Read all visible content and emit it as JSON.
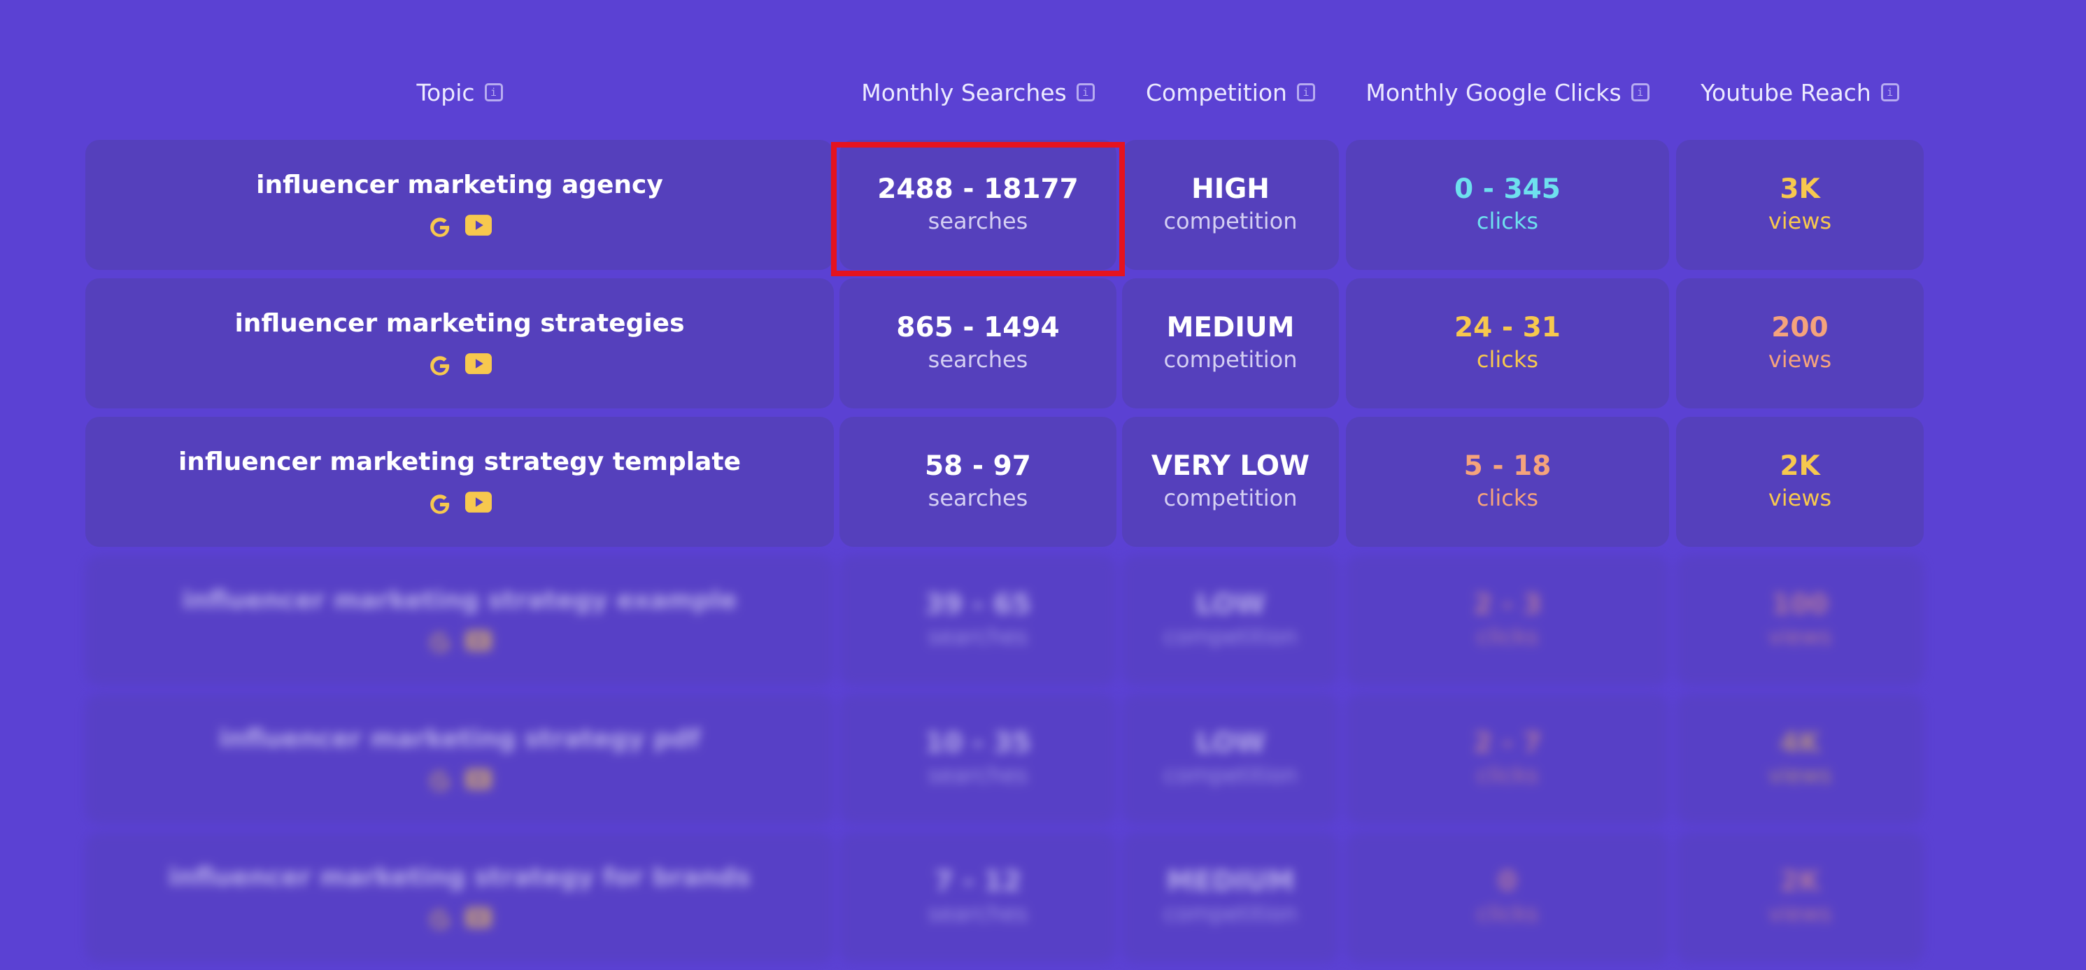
{
  "header": {
    "topic": "Topic",
    "monthly_searches": "Monthly Searches",
    "competition": "Competition",
    "monthly_google_clicks": "Monthly Google Clicks",
    "youtube_reach": "Youtube Reach"
  },
  "colors": {
    "background": "#5b41d3",
    "cell": "#5540bc",
    "cyan": "#6ee0ee",
    "yellow": "#f7c84e",
    "orange": "#f5a37c",
    "highlight": "#e5131f"
  },
  "rows": [
    {
      "topic": "influencer marketing agency",
      "searches": "2488 - 18177",
      "searches_unit": "searches",
      "competition": "HIGH",
      "competition_unit": "competition",
      "clicks": "0 - 345",
      "clicks_unit": "clicks",
      "reach": "3K",
      "reach_unit": "views"
    },
    {
      "topic": "influencer marketing strategies",
      "searches": "865 - 1494",
      "searches_unit": "searches",
      "competition": "MEDIUM",
      "competition_unit": "competition",
      "clicks": "24 - 31",
      "clicks_unit": "clicks",
      "reach": "200",
      "reach_unit": "views"
    },
    {
      "topic": "influencer marketing strategy template",
      "searches": "58 - 97",
      "searches_unit": "searches",
      "competition": "VERY LOW",
      "competition_unit": "competition",
      "clicks": "5 - 18",
      "clicks_unit": "clicks",
      "reach": "2K",
      "reach_unit": "views"
    },
    {
      "topic": "influencer marketing strategy example",
      "searches": "39 - 65",
      "searches_unit": "searches",
      "competition": "LOW",
      "competition_unit": "competition",
      "clicks": "2 - 3",
      "clicks_unit": "clicks",
      "reach": "100",
      "reach_unit": "views"
    },
    {
      "topic": "influencer marketing strategy pdf",
      "searches": "10 - 35",
      "searches_unit": "searches",
      "competition": "LOW",
      "competition_unit": "competition",
      "clicks": "2 - 7",
      "clicks_unit": "clicks",
      "reach": "4K",
      "reach_unit": "views"
    },
    {
      "topic": "influencer marketing strategy for brands",
      "searches": "7 - 12",
      "searches_unit": "searches",
      "competition": "MEDIUM",
      "competition_unit": "competition",
      "clicks": "0",
      "clicks_unit": "clicks",
      "reach": "2K",
      "reach_unit": "views"
    }
  ]
}
